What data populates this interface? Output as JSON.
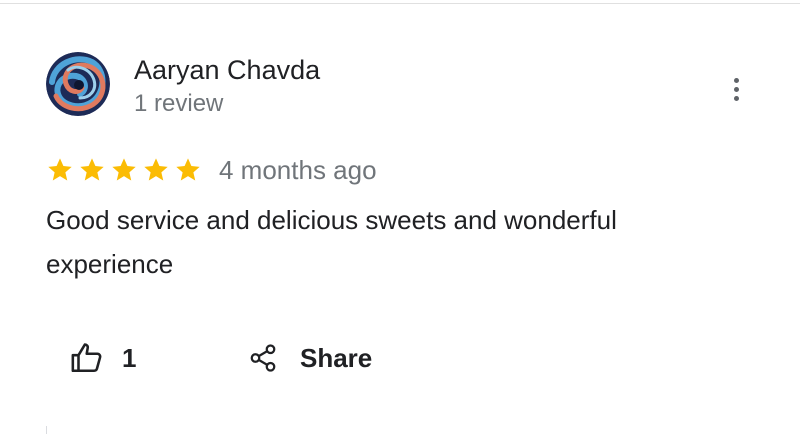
{
  "review": {
    "author_name": "Aaryan Chavda",
    "author_reviews": "1 review",
    "rating": 5,
    "max_rating": 5,
    "date": "4 months ago",
    "text": "Good service and delicious sweets and wonderful experience"
  },
  "actions": {
    "like_count": "1",
    "share_label": "Share"
  },
  "icons": {
    "more": "more-vertical-icon",
    "like": "thumbs-up-icon",
    "share": "share-icon",
    "star": "star-icon"
  },
  "colors": {
    "star": "#fbbc04",
    "secondary_text": "#70757a",
    "primary_text": "#202124"
  }
}
